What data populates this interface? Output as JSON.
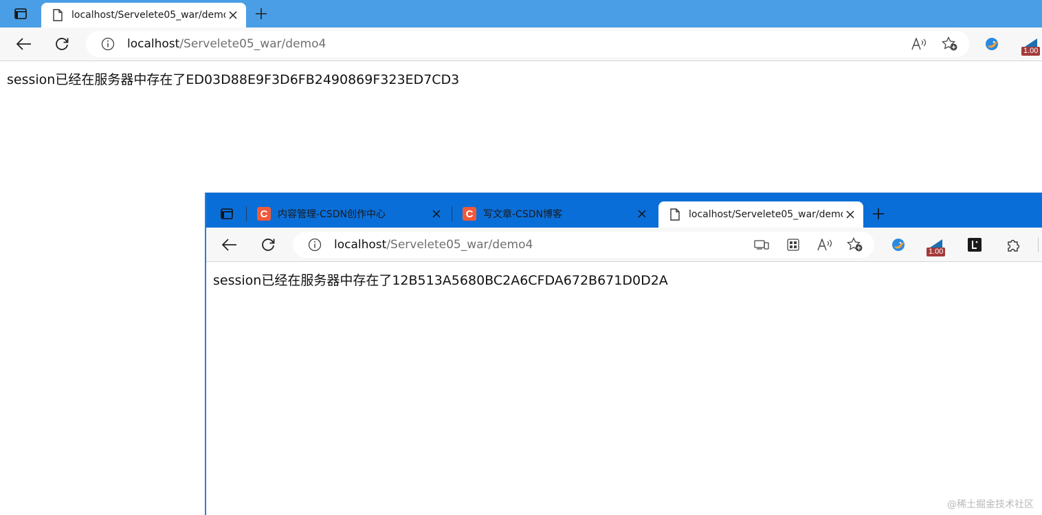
{
  "back_window": {
    "tab": {
      "title": "localhost/Servelete05_war/demo4"
    },
    "address": {
      "host": "localhost",
      "path": "/Servelete05_war/demo4"
    },
    "badge": "1.00",
    "page_text": "session已经在服务器中存在了ED03D88E9F3D6FB2490869F323ED7CD3"
  },
  "front_window": {
    "tabs": [
      {
        "title": "内容管理-CSDN创作中心"
      },
      {
        "title": "写文章-CSDN博客"
      },
      {
        "title": "localhost/Servelete05_war/demo4"
      }
    ],
    "address": {
      "host": "localhost",
      "path": "/Servelete05_war/demo4"
    },
    "badge": "1.00",
    "page_text": "session已经在服务器中存在了12B513A5680BC2A6CFDA672B671D0D2A"
  },
  "watermark": "@稀土掘金技术社区",
  "colors": {
    "back_tabstrip": "#4a9ee6",
    "front_tabstrip": "#0a6ed8",
    "toolbar": "#f7f7f7",
    "csdn": "#f05a3a"
  }
}
